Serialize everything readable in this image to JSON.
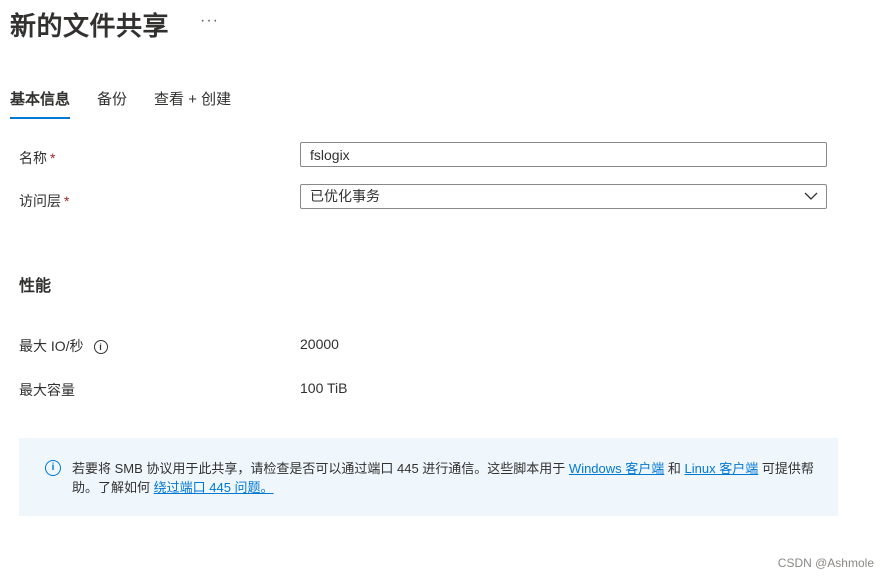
{
  "header": {
    "title": "新的文件共享",
    "more_label": "···"
  },
  "tabs": [
    {
      "label": "基本信息",
      "active": true
    },
    {
      "label": "备份",
      "active": false
    },
    {
      "label": "查看 + 创建",
      "active": false
    }
  ],
  "form": {
    "name_label": "名称",
    "name_value": "fslogix",
    "tier_label": "访问层",
    "tier_value": "已优化事务",
    "required_mark": "*"
  },
  "performance": {
    "section_title": "性能",
    "max_io_label": "最大 IO/秒",
    "max_io_value": "20000",
    "max_capacity_label": "最大容量",
    "max_capacity_value": "100 TiB",
    "info_glyph": "i"
  },
  "banner": {
    "info_glyph": "i",
    "text_prefix": "若要将 SMB 协议用于此共享，请检查是否可以通过端口 445 进行通信。这些脚本用于 ",
    "link_windows": "Windows 客户端",
    "text_and": " 和 ",
    "link_linux": "Linux 客户端",
    "text_mid": " 可提供帮助。了解如何 ",
    "link_port": "绕过端口 445 问题。"
  },
  "watermark": "CSDN @Ashmole",
  "colors": {
    "accent": "#0078d4",
    "required": "#a4262c",
    "banner_bg": "#eff6fc"
  }
}
